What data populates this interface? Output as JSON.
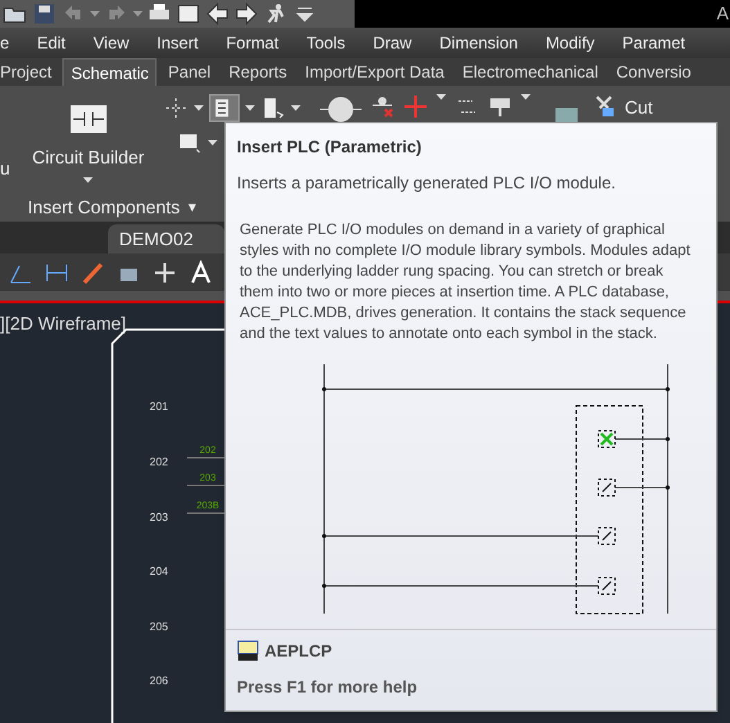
{
  "title_bar": {
    "title": "A"
  },
  "menu": [
    "e",
    "Edit",
    "View",
    "Insert",
    "Format",
    "Tools",
    "Draw",
    "Dimension",
    "Modify",
    "Paramet"
  ],
  "ribbon_tabs": [
    {
      "label": "Project",
      "selected": false
    },
    {
      "label": "Schematic",
      "selected": true
    },
    {
      "label": "Panel",
      "selected": false
    },
    {
      "label": "Reports",
      "selected": false
    },
    {
      "label": "Import/Export Data",
      "selected": false
    },
    {
      "label": "Electromechanical",
      "selected": false
    },
    {
      "label": "Conversio",
      "selected": false
    }
  ],
  "ribbon": {
    "left_label": "u",
    "circuit_builder": "Circuit Builder",
    "cut": "Cut",
    "panel_title": "Insert Components",
    "panel_caret": "▾"
  },
  "file_tabs": [
    {
      "label": "DEMO02",
      "selected": true
    }
  ],
  "viewport": {
    "label": "][2D Wireframe]",
    "rung_numbers": [
      "201",
      "202",
      "203",
      "204",
      "205",
      "206"
    ],
    "wire_labels": [
      "202",
      "203",
      "203B"
    ]
  },
  "tooltip": {
    "title": "Insert PLC (Parametric)",
    "summary": "Inserts a parametrically generated PLC I/O module.",
    "description": "Generate PLC I/O modules on demand in a variety of graphical styles with no complete I/O module library symbols. Modules adapt to the underlying ladder rung spacing. You can stretch or break them into two or more pieces at insertion time. A PLC database, ACE_PLC.MDB, drives generation. It contains the stack sequence and the text values to annotate onto each symbol in the stack.",
    "command": "AEPLCP",
    "help": "Press F1 for more help"
  }
}
